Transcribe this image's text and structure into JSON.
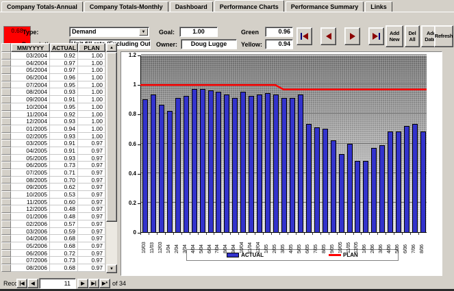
{
  "tabs": [
    {
      "label": "Company Totals-Annual",
      "active": false
    },
    {
      "label": "Company Totals-Monthly",
      "active": false
    },
    {
      "label": "Dashboard",
      "active": false
    },
    {
      "label": "Performance Charts",
      "active": true
    },
    {
      "label": "Performance Summary",
      "active": false
    },
    {
      "label": "Links",
      "active": false
    }
  ],
  "header": {
    "status_value": "0.68",
    "status_color": "#ff0000",
    "type_label": "Type:",
    "type_value": "Demand",
    "description_label": "Description:",
    "description_value": "Unit fill rate (Excluding Outsourci",
    "goal_label": "Goal:",
    "goal_value": "1.00",
    "owner_label": "Owner:",
    "owner_value": "Doug Lugge",
    "green_label": "Green",
    "green_value": "0.96",
    "yellow_label": "Yellow:",
    "yellow_value": "0.94",
    "buttons": {
      "add_new": "Add New",
      "del_all": "Del All",
      "add_dates": "Add Dates",
      "refresh": "Refresh"
    }
  },
  "table": {
    "columns": [
      "MM/YYYY",
      "ACTUAL",
      "PLAN"
    ],
    "rows": [
      [
        "03/2004",
        "0.92",
        "1.00"
      ],
      [
        "04/2004",
        "0.97",
        "1.00"
      ],
      [
        "05/2004",
        "0.97",
        "1.00"
      ],
      [
        "06/2004",
        "0.96",
        "1.00"
      ],
      [
        "07/2004",
        "0.95",
        "1.00"
      ],
      [
        "08/2004",
        "0.93",
        "1.00"
      ],
      [
        "09/2004",
        "0.91",
        "1.00"
      ],
      [
        "10/2004",
        "0.95",
        "1.00"
      ],
      [
        "11/2004",
        "0.92",
        "1.00"
      ],
      [
        "12/2004",
        "0.93",
        "1.00"
      ],
      [
        "01/2005",
        "0.94",
        "1.00"
      ],
      [
        "02/2005",
        "0.93",
        "1.00"
      ],
      [
        "03/2005",
        "0.91",
        "0.97"
      ],
      [
        "04/2005",
        "0.91",
        "0.97"
      ],
      [
        "05/2005",
        "0.93",
        "0.97"
      ],
      [
        "06/2005",
        "0.73",
        "0.97"
      ],
      [
        "07/2005",
        "0.71",
        "0.97"
      ],
      [
        "08/2005",
        "0.70",
        "0.97"
      ],
      [
        "09/2005",
        "0.62",
        "0.97"
      ],
      [
        "10/2005",
        "0.53",
        "0.97"
      ],
      [
        "11/2005",
        "0.60",
        "0.97"
      ],
      [
        "12/2005",
        "0.48",
        "0.97"
      ],
      [
        "01/2006",
        "0.48",
        "0.97"
      ],
      [
        "02/2006",
        "0.57",
        "0.97"
      ],
      [
        "03/2006",
        "0.59",
        "0.97"
      ],
      [
        "04/2006",
        "0.68",
        "0.97"
      ],
      [
        "05/2006",
        "0.68",
        "0.97"
      ],
      [
        "06/2006",
        "0.72",
        "0.97"
      ],
      [
        "07/2006",
        "0.73",
        "0.97"
      ],
      [
        "08/2006",
        "0.68",
        "0.97"
      ]
    ]
  },
  "record_nav": {
    "label": "Record:",
    "current": "11",
    "total_text": "of 34"
  },
  "chart_data": {
    "type": "bar",
    "title": "",
    "xlabel": "",
    "ylabel": "",
    "ylim": [
      0,
      1.2
    ],
    "yticks": [
      0,
      0.2,
      0.4,
      0.6,
      0.8,
      1,
      1.2
    ],
    "grid": true,
    "legend_position": "bottom",
    "categories": [
      "10/03",
      "11/03",
      "12/03",
      "1/04",
      "2/04",
      "3/04",
      "4/04",
      "5/04",
      "6/04",
      "7/04",
      "8/04",
      "9/04",
      "10/04",
      "11/04",
      "12/04",
      "1/05",
      "2/05",
      "3/05",
      "4/05",
      "5/05",
      "6/05",
      "7/05",
      "8/05",
      "9/05",
      "10/05",
      "11/05",
      "12/05",
      "1/06",
      "2/06",
      "3/06",
      "4/06",
      "5/06",
      "6/06",
      "7/06",
      "8/06"
    ],
    "series": [
      {
        "name": "ACTUAL",
        "type": "bar",
        "color": "#3333cc",
        "values": [
          0.9,
          0.93,
          0.86,
          0.82,
          0.91,
          0.92,
          0.97,
          0.97,
          0.96,
          0.95,
          0.93,
          0.91,
          0.95,
          0.92,
          0.93,
          0.94,
          0.93,
          0.91,
          0.91,
          0.93,
          0.73,
          0.71,
          0.7,
          0.62,
          0.53,
          0.6,
          0.48,
          0.48,
          0.57,
          0.59,
          0.68,
          0.68,
          0.72,
          0.73,
          0.68
        ]
      },
      {
        "name": "PLAN",
        "type": "line",
        "color": "#ff0000",
        "values": [
          1.0,
          1.0,
          1.0,
          1.0,
          1.0,
          1.0,
          1.0,
          1.0,
          1.0,
          1.0,
          1.0,
          1.0,
          1.0,
          1.0,
          1.0,
          1.0,
          1.0,
          0.97,
          0.97,
          0.97,
          0.97,
          0.97,
          0.97,
          0.97,
          0.97,
          0.97,
          0.97,
          0.97,
          0.97,
          0.97,
          0.97,
          0.97,
          0.97,
          0.97,
          0.97
        ]
      }
    ]
  }
}
